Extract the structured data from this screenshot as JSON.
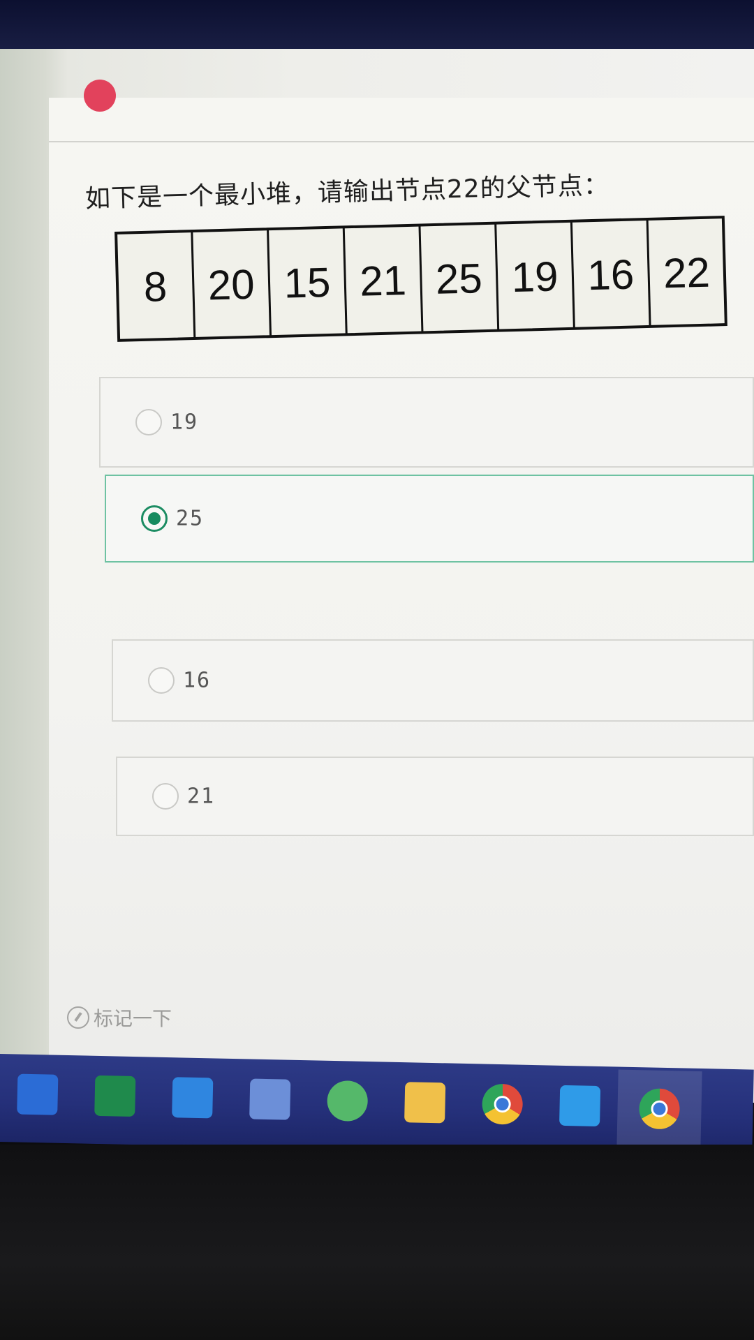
{
  "question": "如下是一个最小堆，请输出节点22的父节点：",
  "heap_array": [
    "8",
    "20",
    "15",
    "21",
    "25",
    "19",
    "16",
    "22"
  ],
  "options": [
    {
      "label": "19",
      "selected": false
    },
    {
      "label": "25",
      "selected": true
    },
    {
      "label": "16",
      "selected": false
    },
    {
      "label": "21",
      "selected": false
    }
  ],
  "mark_label": "标记一下",
  "taskbar": [
    {
      "icon": "word-icon",
      "color": "#2b6cd6",
      "active": false
    },
    {
      "icon": "excel-icon",
      "color": "#1f8a4c",
      "active": false
    },
    {
      "icon": "edge-icon",
      "color": "#2f86e0",
      "active": false
    },
    {
      "icon": "document-icon",
      "color": "#6c8fd8",
      "active": false
    },
    {
      "icon": "chat-app-icon",
      "color": "#55b86a",
      "active": false
    },
    {
      "icon": "file-explorer-icon",
      "color": "#f0c04a",
      "active": false
    },
    {
      "icon": "chrome-icon",
      "color": "#e04a3b",
      "active": false
    },
    {
      "icon": "vscode-icon",
      "color": "#2f9be8",
      "active": false
    },
    {
      "icon": "chrome-icon",
      "color": "#e04a3b",
      "active": true
    }
  ],
  "colors": {
    "accent": "#168a5e",
    "taskbar": "#25307a"
  }
}
